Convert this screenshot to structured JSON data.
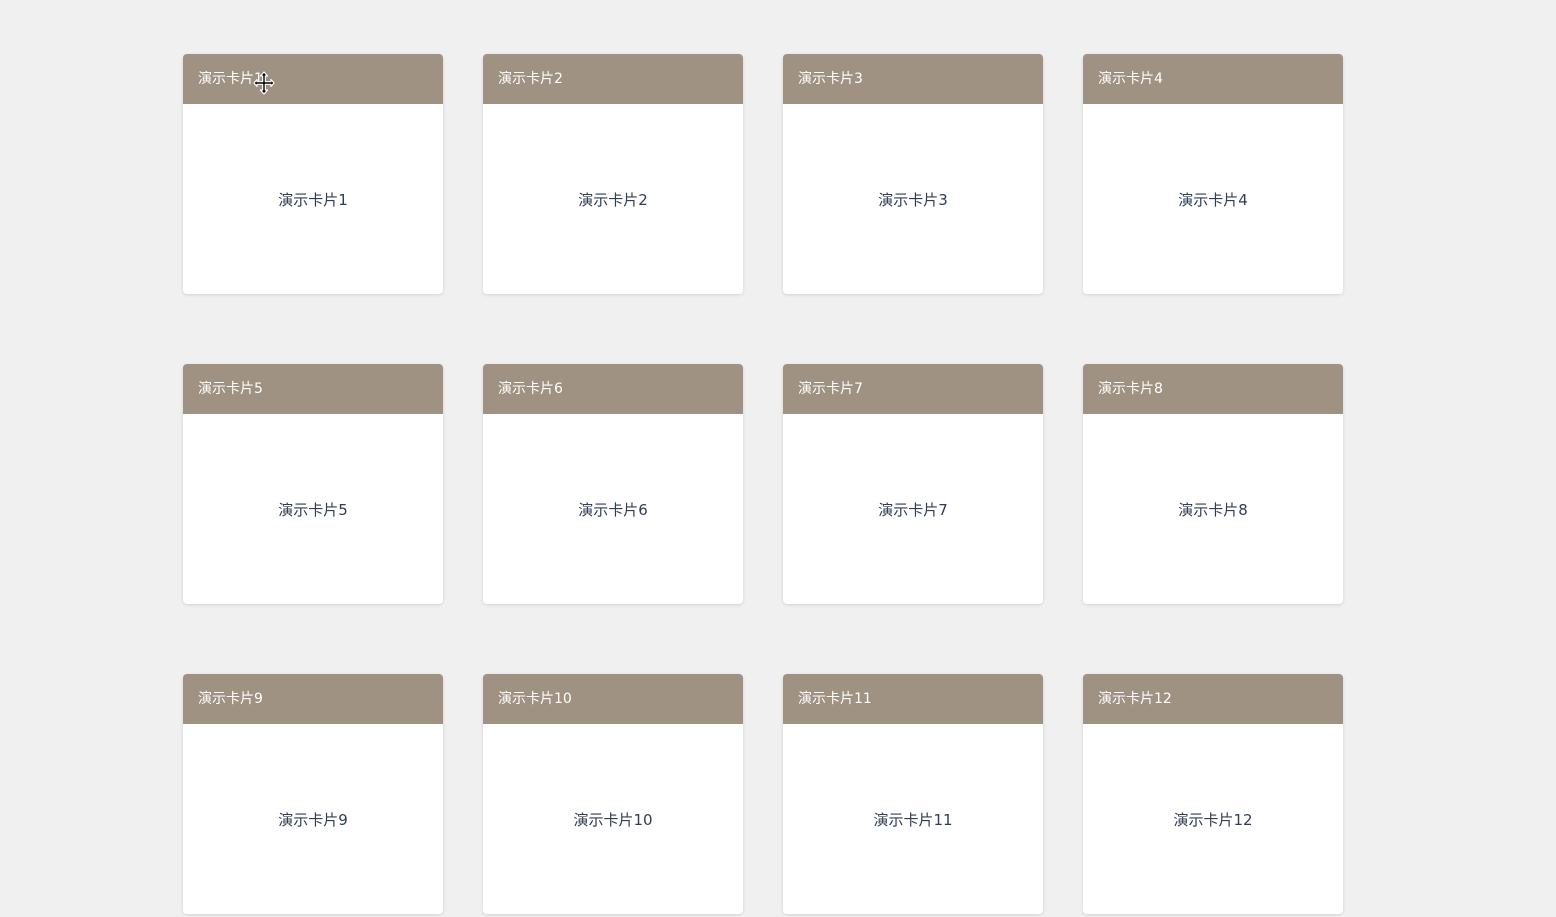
{
  "cards": [
    {
      "title": "演示卡片1",
      "body": "演示卡片1"
    },
    {
      "title": "演示卡片2",
      "body": "演示卡片2"
    },
    {
      "title": "演示卡片3",
      "body": "演示卡片3"
    },
    {
      "title": "演示卡片4",
      "body": "演示卡片4"
    },
    {
      "title": "演示卡片5",
      "body": "演示卡片5"
    },
    {
      "title": "演示卡片6",
      "body": "演示卡片6"
    },
    {
      "title": "演示卡片7",
      "body": "演示卡片7"
    },
    {
      "title": "演示卡片8",
      "body": "演示卡片8"
    },
    {
      "title": "演示卡片9",
      "body": "演示卡片9"
    },
    {
      "title": "演示卡片10",
      "body": "演示卡片10"
    },
    {
      "title": "演示卡片11",
      "body": "演示卡片11"
    },
    {
      "title": "演示卡片12",
      "body": "演示卡片12"
    }
  ],
  "colors": {
    "header_bg": "#a09282",
    "page_bg": "#f0f0f0",
    "body_text": "#2f3e52"
  },
  "cursor_icon": "move-cursor-icon"
}
